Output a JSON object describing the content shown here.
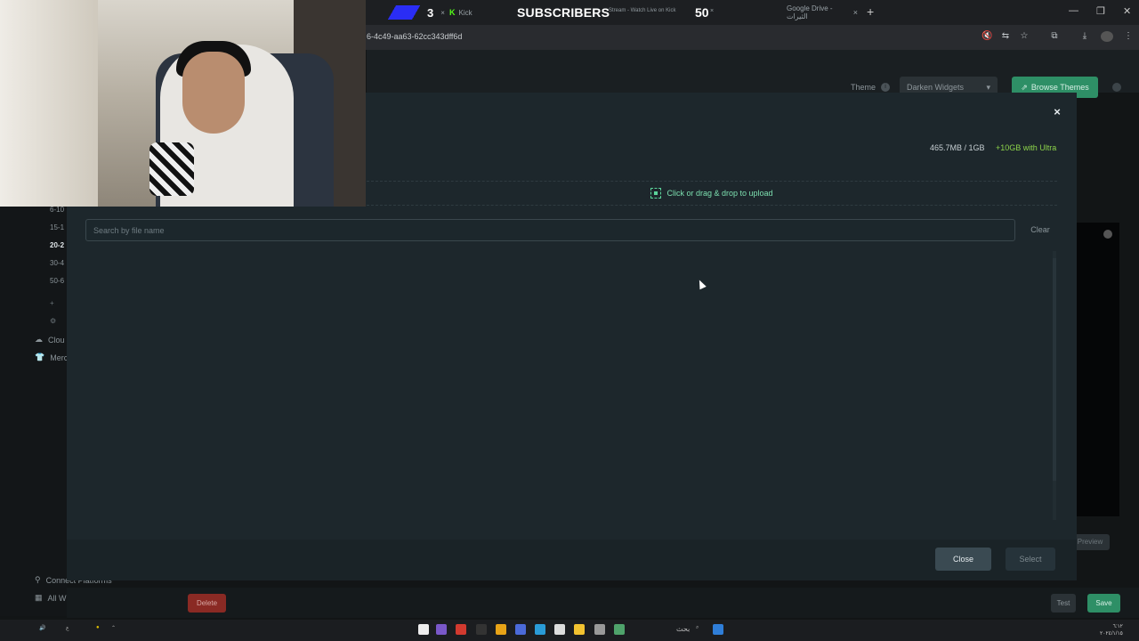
{
  "browser": {
    "url": "6-4c49-aa63-62cc343dff6d",
    "tabs": [
      {
        "label": "Kick",
        "close": "×"
      },
      {
        "label": "Google Drive - الثيرات",
        "close": "×"
      }
    ],
    "new_tab": "+",
    "stream_meta": "Stream - Watch Live on Kick"
  },
  "overlay": {
    "sub_count": "3",
    "sub_count_x": "×",
    "label": "SUBSCRIBERS",
    "goal": "50",
    "goal_x": "×"
  },
  "dashboard": {
    "theme_label": "Theme",
    "theme_value": "Darken Widgets",
    "browse_themes": "Browse Themes",
    "sidebar": [
      "6-10",
      "15-1",
      "20-2",
      "30-4",
      "50-6"
    ],
    "sidebar_active_index": 2,
    "sidebar_links": [
      "Clou",
      "Merc"
    ],
    "connect_platforms": "Connect Platforms",
    "all_widgets": "All Widgets",
    "preview": "Preview",
    "delete": "Delete",
    "test": "Test",
    "save": "Save"
  },
  "modal": {
    "close_x": "×",
    "storage": "465.7MB / 1GB",
    "ultra": "+10GB with Ultra",
    "dropzone": "Click or drag & drop to upload",
    "search_placeholder": "Search by file name",
    "search_value": "",
    "clear": "Clear",
    "close": "Close",
    "select": "Select"
  },
  "taskbar": {
    "search": "بحث",
    "clock_time": "٦:١٢",
    "clock_date": "٢٠٢٤/١/١٥"
  },
  "colors": {
    "accent_green": "#2e8f66",
    "ultra_green": "#8cd34a",
    "drop_green": "#7de0b0",
    "delete_red": "#8a2a24",
    "modal_bg": "#1d272c"
  }
}
